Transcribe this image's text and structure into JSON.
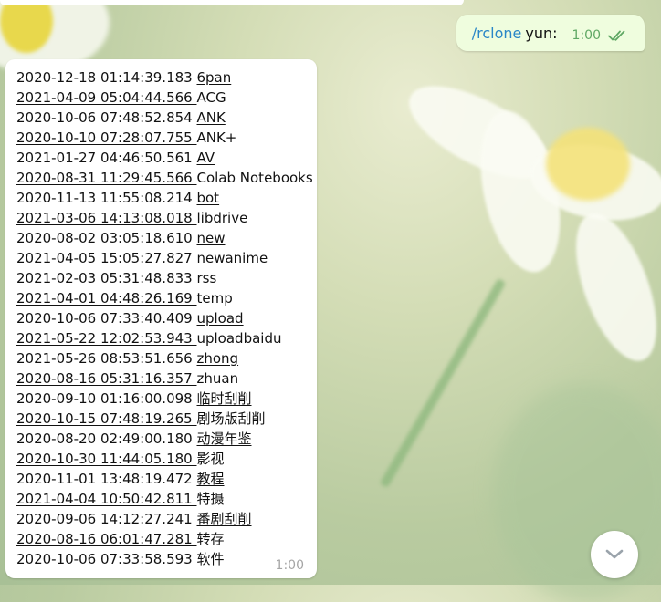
{
  "outgoing_message": {
    "command": "/rclone",
    "text": "yun:",
    "time": "1:00",
    "status": "read-double-check-icon"
  },
  "incoming_message": {
    "time": "1:00",
    "rows": [
      {
        "timestamp": "2020-12-18 01:14:39.183 ",
        "name": "6pan",
        "ts_ul": false,
        "name_ul": true
      },
      {
        "timestamp": "2021-04-09 05:04:44.566 ",
        "name": "ACG",
        "ts_ul": true,
        "name_ul": false
      },
      {
        "timestamp": "2020-10-06 07:48:52.854 ",
        "name": "ANK",
        "ts_ul": false,
        "name_ul": true
      },
      {
        "timestamp": "2020-10-10 07:28:07.755 ",
        "name": "ANK+",
        "ts_ul": true,
        "name_ul": false
      },
      {
        "timestamp": "2021-01-27 04:46:50.561 ",
        "name": "AV",
        "ts_ul": false,
        "name_ul": true
      },
      {
        "timestamp": "2020-08-31 11:29:45.566 ",
        "name": "Colab Notebooks",
        "ts_ul": true,
        "name_ul": false
      },
      {
        "timestamp": "2020-11-13 11:55:08.214 ",
        "name": "bot",
        "ts_ul": false,
        "name_ul": true
      },
      {
        "timestamp": "2021-03-06 14:13:08.018 ",
        "name": "libdrive",
        "ts_ul": true,
        "name_ul": false
      },
      {
        "timestamp": "2020-08-02 03:05:18.610 ",
        "name": "new",
        "ts_ul": false,
        "name_ul": true
      },
      {
        "timestamp": "2021-04-05 15:05:27.827 ",
        "name": "newanime",
        "ts_ul": true,
        "name_ul": false
      },
      {
        "timestamp": "2021-02-03 05:31:48.833 ",
        "name": "rss",
        "ts_ul": false,
        "name_ul": true
      },
      {
        "timestamp": "2021-04-01 04:48:26.169 ",
        "name": "temp",
        "ts_ul": true,
        "name_ul": false
      },
      {
        "timestamp": "2020-10-06 07:33:40.409 ",
        "name": "upload",
        "ts_ul": false,
        "name_ul": true
      },
      {
        "timestamp": "2021-05-22 12:02:53.943 ",
        "name": "uploadbaidu",
        "ts_ul": true,
        "name_ul": false
      },
      {
        "timestamp": "2021-05-26 08:53:51.656 ",
        "name": "zhong",
        "ts_ul": false,
        "name_ul": true
      },
      {
        "timestamp": "2020-08-16 05:31:16.357 ",
        "name": "zhuan",
        "ts_ul": true,
        "name_ul": false
      },
      {
        "timestamp": "2020-09-10 01:16:00.098 ",
        "name": "临时刮削",
        "ts_ul": false,
        "name_ul": true
      },
      {
        "timestamp": "2020-10-15 07:48:19.265 ",
        "name": "剧场版刮削",
        "ts_ul": true,
        "name_ul": false
      },
      {
        "timestamp": "2020-08-20 02:49:00.180 ",
        "name": "动漫年鉴",
        "ts_ul": false,
        "name_ul": true
      },
      {
        "timestamp": "2020-10-30 11:44:05.180 ",
        "name": "影视",
        "ts_ul": true,
        "name_ul": false
      },
      {
        "timestamp": "2020-11-01 13:48:19.472 ",
        "name": "教程",
        "ts_ul": false,
        "name_ul": true
      },
      {
        "timestamp": "2021-04-04 10:50:42.811 ",
        "name": "特摄",
        "ts_ul": true,
        "name_ul": false
      },
      {
        "timestamp": "2020-09-06 14:12:27.241 ",
        "name": "番剧刮削",
        "ts_ul": false,
        "name_ul": true
      },
      {
        "timestamp": "2020-08-16 06:01:47.281 ",
        "name": "转存",
        "ts_ul": true,
        "name_ul": false
      },
      {
        "timestamp": "2020-10-06 07:33:58.593 ",
        "name": "软件",
        "ts_ul": false,
        "name_ul": false
      }
    ]
  },
  "scroll_button": {
    "icon": "chevron-down-icon"
  },
  "colors": {
    "outgoing_bubble": "#effdde",
    "incoming_bubble": "#ffffff",
    "command_link": "#2a87c7",
    "time_outgoing": "#5fa864",
    "time_incoming": "#a5a5a5"
  }
}
